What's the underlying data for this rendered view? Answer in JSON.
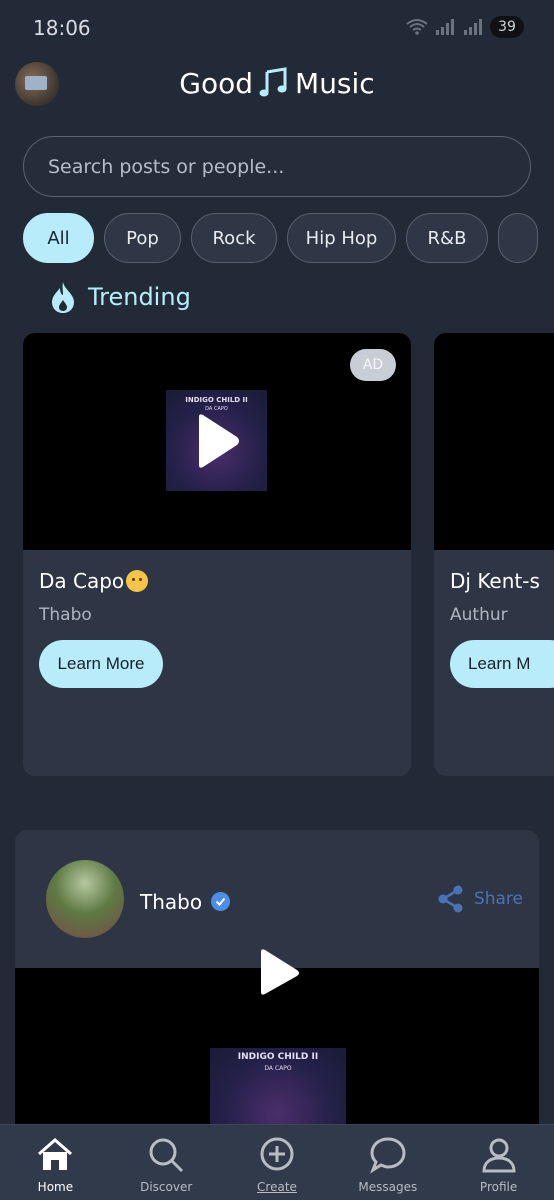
{
  "status_bar": {
    "time": "18:06",
    "battery": "39"
  },
  "header": {
    "logo_left": "Good",
    "logo_right": "Music"
  },
  "search": {
    "placeholder": "Search posts or people..."
  },
  "filters": [
    "All",
    "Pop",
    "Rock",
    "Hip Hop",
    "R&B"
  ],
  "trending": {
    "title": "Trending",
    "cards": [
      {
        "title": "Da Capo",
        "author": "Thabo",
        "badge": "AD",
        "button": "Learn More",
        "album_title": "INDIGO CHILD II",
        "album_artist": "DA CAPO"
      },
      {
        "title": "Dj Kent-s",
        "author": "Authur",
        "button": "Learn M"
      }
    ]
  },
  "post": {
    "author": "Thabo",
    "share_label": "Share",
    "album_title": "INDIGO CHILD II",
    "album_artist": "DA CAPO"
  },
  "nav": {
    "items": [
      {
        "label": "Home",
        "icon": "home-icon"
      },
      {
        "label": "Discover",
        "icon": "search-icon"
      },
      {
        "label": "Create",
        "icon": "plus-circle-icon"
      },
      {
        "label": "Messages",
        "icon": "chat-icon"
      },
      {
        "label": "Profile",
        "icon": "person-icon"
      }
    ]
  },
  "colors": {
    "accent": "#b9ecfb",
    "background": "#232a37",
    "card": "#2e3646",
    "share": "#4a72b8"
  }
}
